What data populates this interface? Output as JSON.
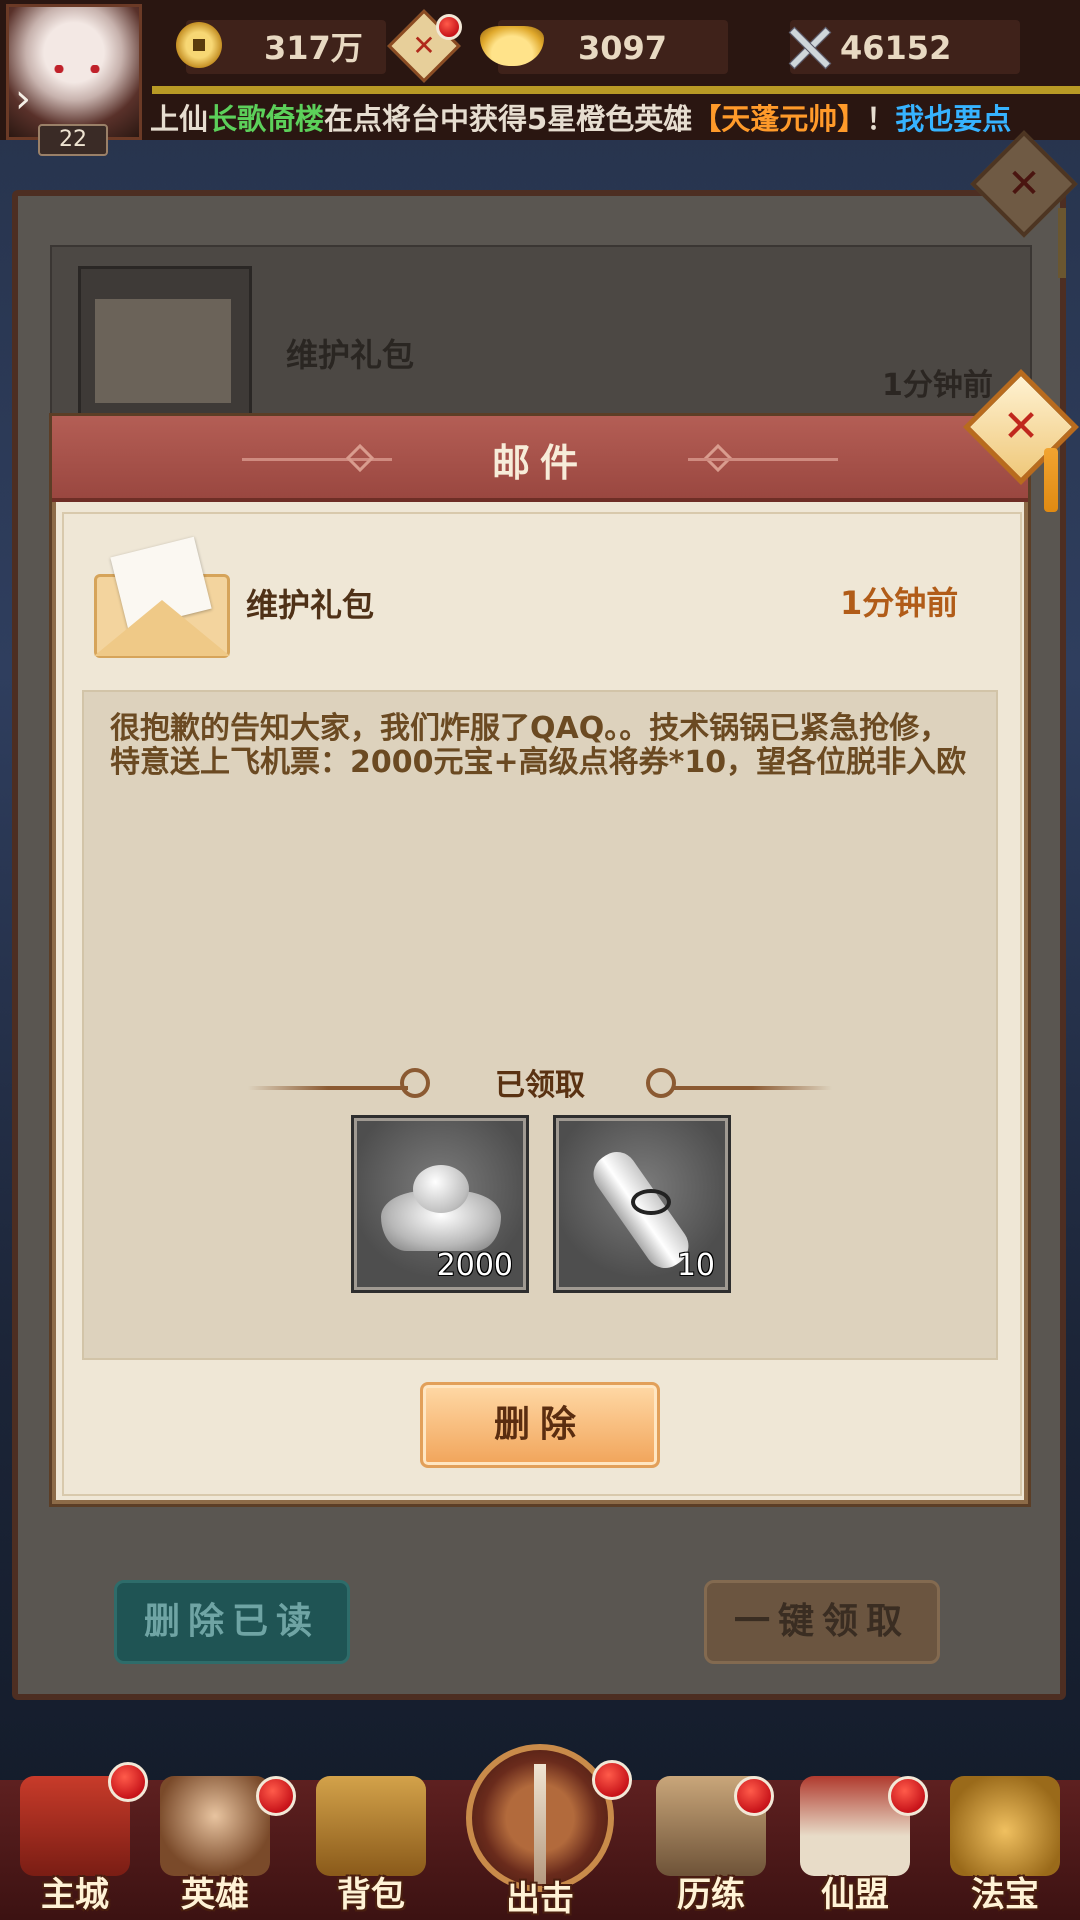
{
  "topbar": {
    "level": "22",
    "copper": "317万",
    "ingots": "3097",
    "power": "46152",
    "ticker": [
      {
        "text": "上仙",
        "color": "white"
      },
      {
        "text": "长歌倚楼",
        "color": "green"
      },
      {
        "text": "在点将台中获得5星橙色英雄",
        "color": "white"
      },
      {
        "text": "【天蓬元帅】",
        "color": "orange"
      },
      {
        "text": "！",
        "color": "white"
      },
      {
        "text": "我也要点",
        "color": "cyan"
      }
    ]
  },
  "mail_list": {
    "item_title": "维护礼包",
    "item_time": "1分钟前",
    "delete_read_label": "删除已读",
    "claim_all_label": "一键领取"
  },
  "modal": {
    "title": "邮件",
    "mail_title": "维护礼包",
    "mail_time": "1分钟前",
    "body": "很抱歉的告知大家，我们炸服了QAQ。。技术锅锅已紧急抢修，特意送上飞机票：2000元宝+高级点将券*10，望各位脱非入欧",
    "claimed_label": "已领取",
    "rewards": [
      {
        "icon": "silver-ingot-icon",
        "count": "2000"
      },
      {
        "icon": "scroll-ticket-icon",
        "count": "10"
      }
    ],
    "delete_label": "删除"
  },
  "nav": {
    "items": [
      {
        "label": "主城",
        "badge": true
      },
      {
        "label": "英雄",
        "badge": true
      },
      {
        "label": "背包",
        "badge": false
      },
      {
        "label": "出击",
        "badge": true
      },
      {
        "label": "历练",
        "badge": true
      },
      {
        "label": "仙盟",
        "badge": true
      },
      {
        "label": "法宝",
        "badge": false
      }
    ]
  },
  "colors": {
    "modal_header": "#a44f47",
    "modal_bg": "#efe7d6",
    "time_orange": "#b15c18",
    "delete_read_teal": "#1f5454",
    "delete_btn": "#f1a45a"
  }
}
